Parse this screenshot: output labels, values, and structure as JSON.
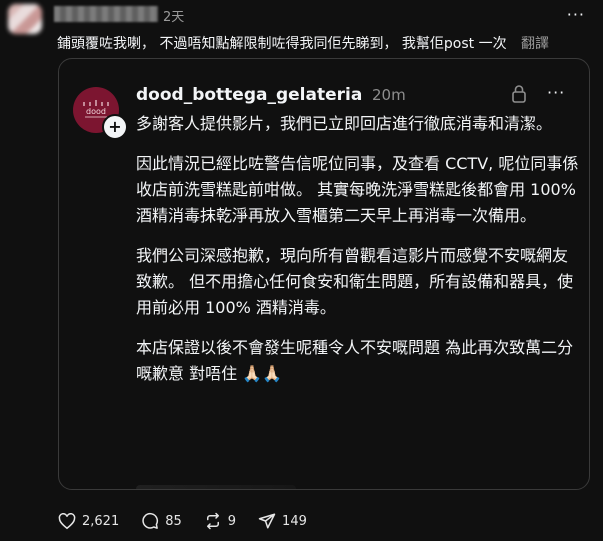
{
  "post": {
    "time": "2天",
    "more_label": "···",
    "text": "鋪頭覆咗我喇， 不過唔知點解限制咗得我同佢先睇到， 我幫佢post 一次",
    "translate_label": "翻譯"
  },
  "quoted": {
    "username": "dood_bottega_gelateria",
    "time": "20m",
    "more_label": "···",
    "avatar_text": "dood",
    "paragraphs": [
      "多謝客人提供影片，我們已立即回店進行徹底消毒和清潔。",
      "因此情況已經比咗警告信呢位同事，及查看 CCTV, 呢位同事係收店前洗雪糕匙前咁做。 其實每晚洗淨雪糕匙後都會用 100% 酒精消毒抹乾淨再放入雪櫃第二天早上再消毒一次備用。",
      "我們公司深感抱歉，現向所有曾觀看這影片而感覺不安嘅網友致歉。 但不用擔心任何食安和衛生問題，所有設備和器具，使用前必用 100% 酒精消毒。",
      "本店保證以後不會發生呢種令人不安嘅問題 為此再次致萬二分嘅歉意 對唔住 🙏🏻🙏🏻"
    ]
  },
  "actions": {
    "likes": "2,621",
    "comments": "85",
    "reposts": "9",
    "shares": "149"
  },
  "colors": {
    "background": "#101010",
    "text": "#f3f5f7",
    "muted": "#8e8e8e",
    "border": "#3a3a3a",
    "avatar_brand": "#7c1530"
  },
  "icons": [
    "more-icon",
    "plus-icon",
    "lock-icon",
    "heart-icon",
    "comment-icon",
    "repost-icon",
    "share-icon"
  ]
}
